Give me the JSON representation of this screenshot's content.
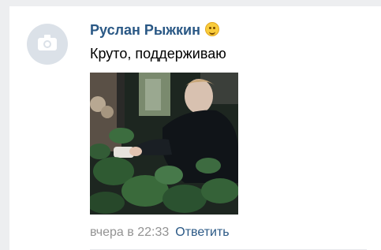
{
  "comment": {
    "author": "Руслан Рыжкин",
    "author_emoji": "smiling-face-icon",
    "text": "Круто, поддерживаю",
    "date": "вчера в 22:33",
    "reply_label": "Ответить"
  },
  "avatar": {
    "icon": "camera-icon",
    "bg_color": "#dbe1e8"
  },
  "attachment": {
    "type": "photo"
  },
  "colors": {
    "link": "#2a5885",
    "meta": "#939393",
    "page_bg": "#edeef0"
  }
}
